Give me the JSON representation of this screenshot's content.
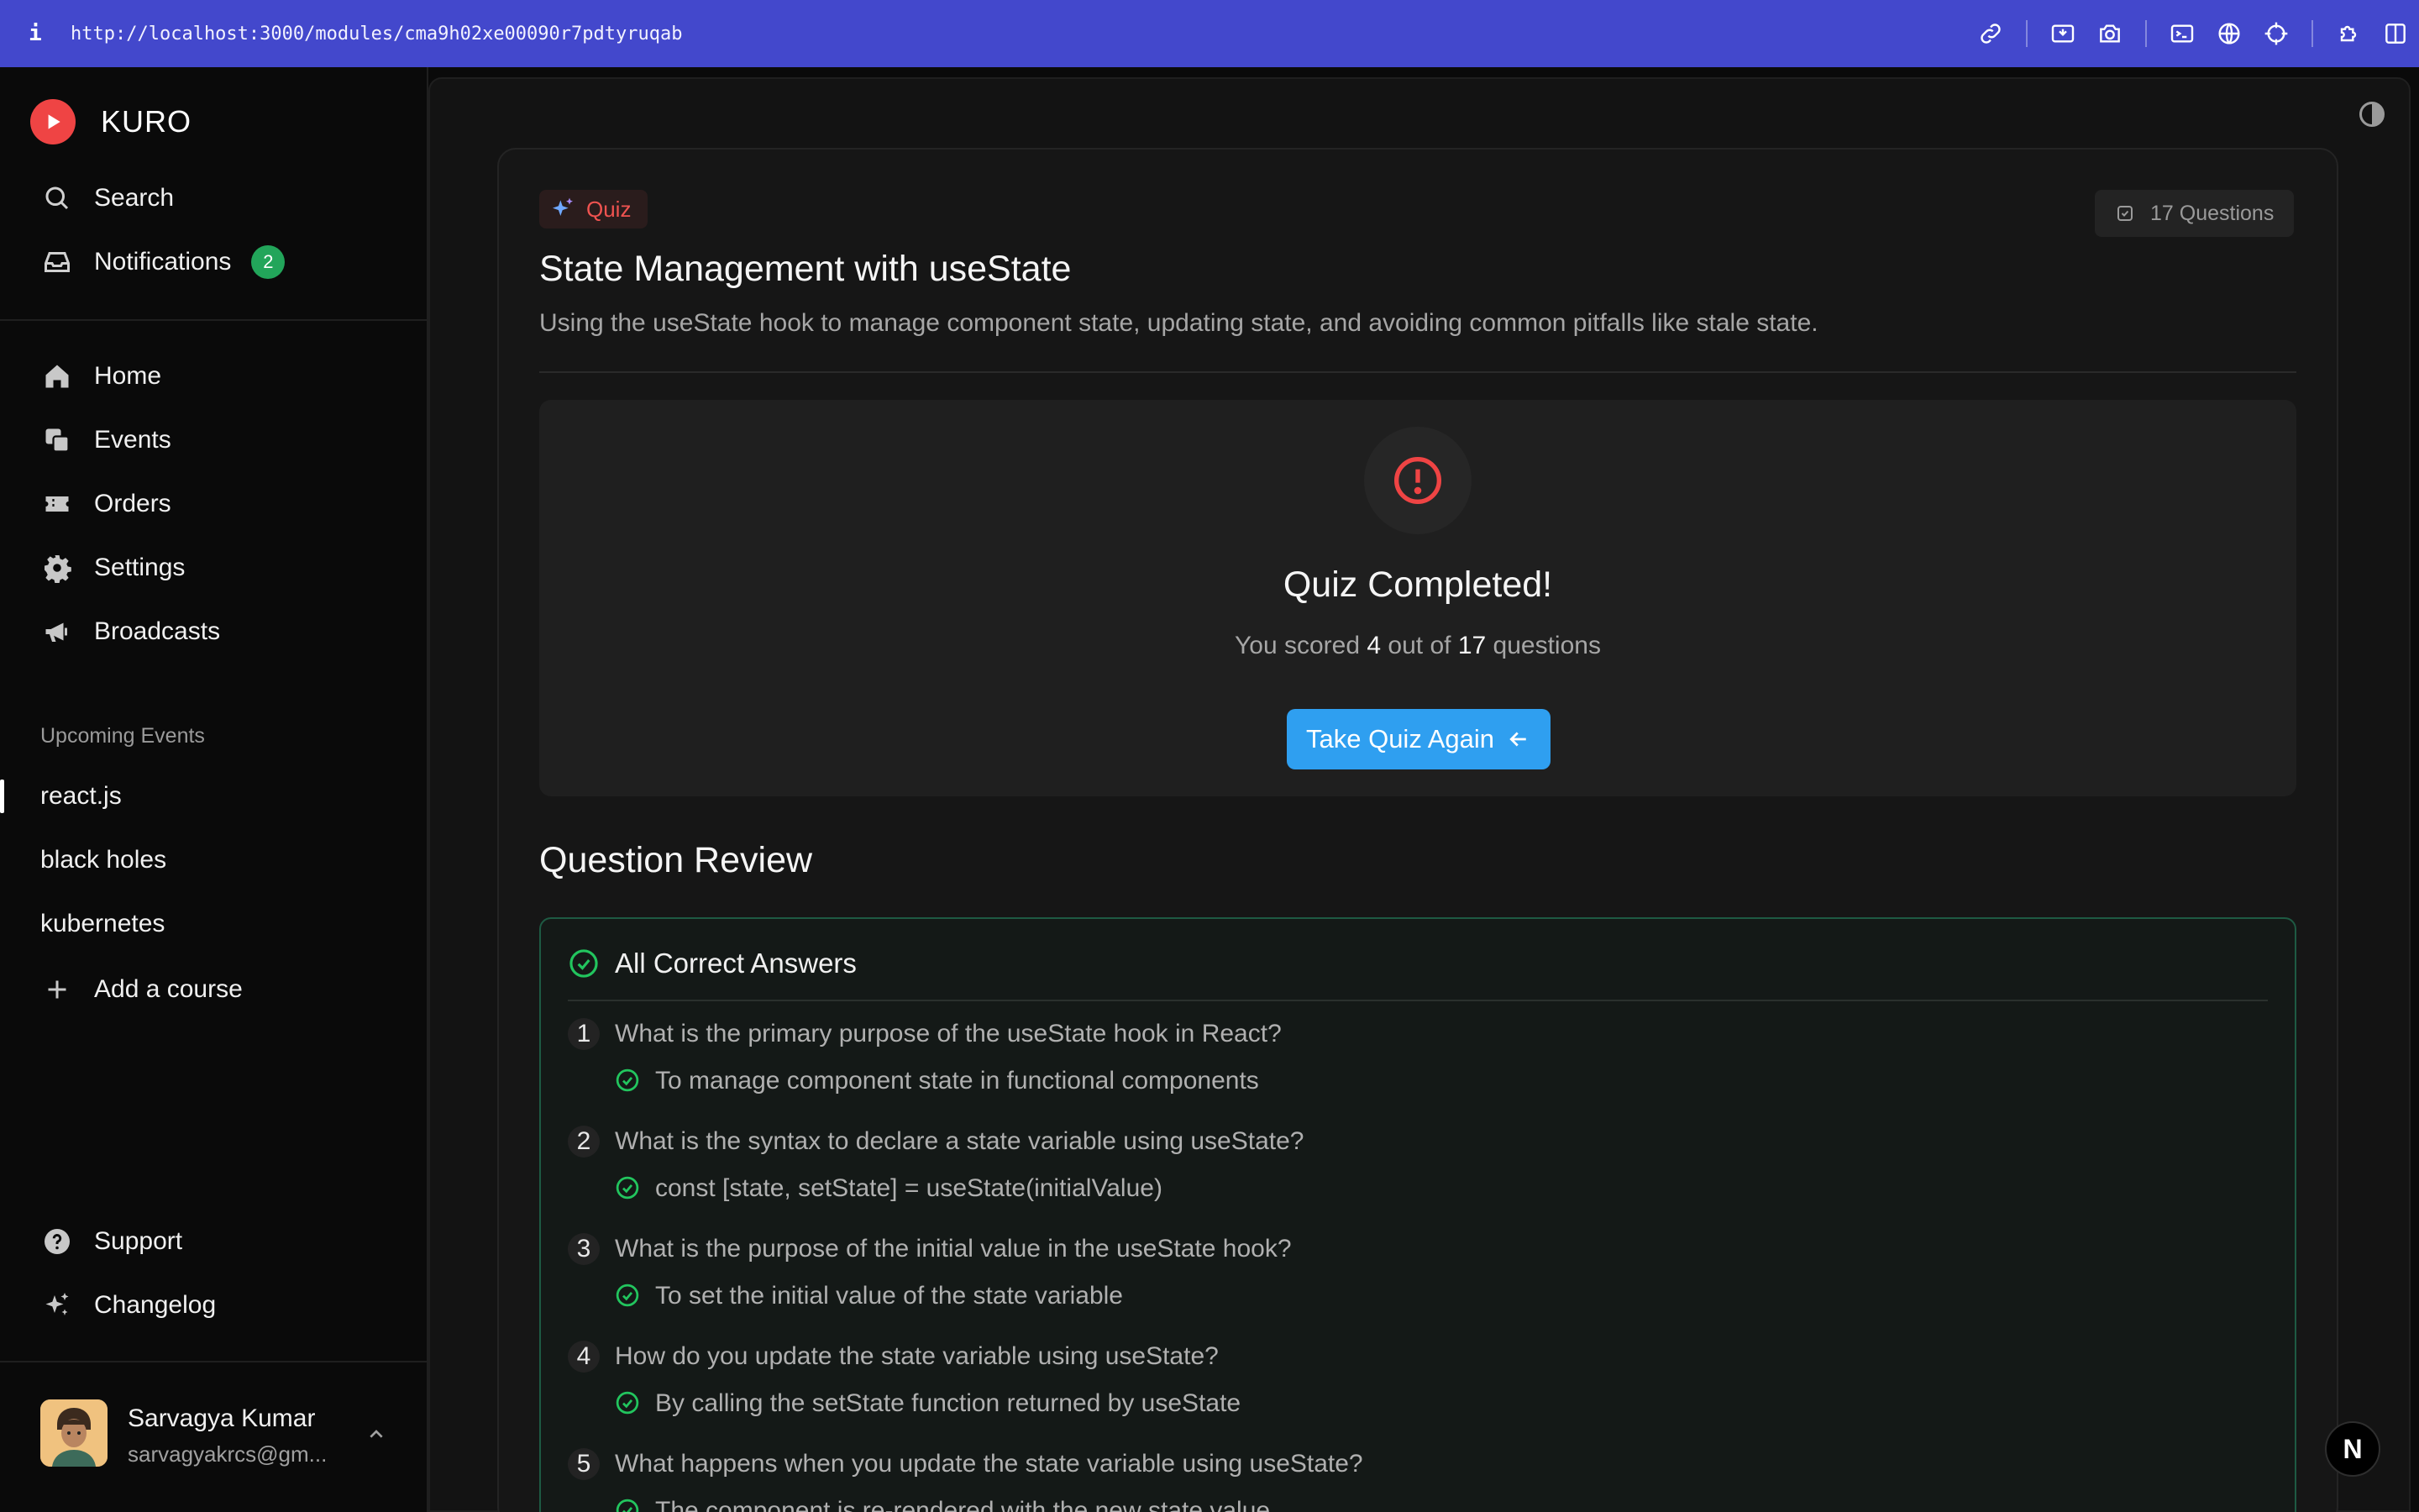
{
  "browser": {
    "info": "i",
    "url": "http://localhost:3000/modules/cma9h02xe00090r7pdtyruqab"
  },
  "sidebar": {
    "brand": "KURO",
    "search": "Search",
    "notifications": "Notifications",
    "notifications_count": "2",
    "nav": {
      "home": "Home",
      "events": "Events",
      "orders": "Orders",
      "settings": "Settings",
      "broadcasts": "Broadcasts"
    },
    "upcoming_label": "Upcoming Events",
    "courses": [
      "react.js",
      "black holes",
      "kubernetes"
    ],
    "add_course": "Add a course",
    "support": "Support",
    "changelog": "Changelog",
    "user": {
      "name": "Sarvagya Kumar",
      "email": "sarvagyakrcs@gm..."
    }
  },
  "module": {
    "tag": "Quiz",
    "question_count": "17 Questions",
    "title": "State Management with useState",
    "description": "Using the useState hook to manage component state, updating state, and avoiding common pitfalls like stale state."
  },
  "result": {
    "heading": "Quiz Completed!",
    "score_prefix": "You scored",
    "score": "4",
    "score_mid": "out of",
    "total": "17",
    "score_suffix": "questions",
    "retake_label": "Take Quiz Again"
  },
  "review": {
    "title": "Question Review",
    "answers_heading": "All Correct Answers",
    "items": [
      {
        "num": "1",
        "question": "What is the primary purpose of the useState hook in React?",
        "answer": "To manage component state in functional components"
      },
      {
        "num": "2",
        "question": "What is the syntax to declare a state variable using useState?",
        "answer": "const [state, setState] = useState(initialValue)"
      },
      {
        "num": "3",
        "question": "What is the purpose of the initial value in the useState hook?",
        "answer": "To set the initial value of the state variable"
      },
      {
        "num": "4",
        "question": "How do you update the state variable using useState?",
        "answer": "By calling the setState function returned by useState"
      },
      {
        "num": "5",
        "question": "What happens when you update the state variable using useState?",
        "answer": "The component is re-rendered with the new state value"
      }
    ]
  },
  "dev_badge": "N",
  "colors": {
    "accent": "#2f9ff0",
    "danger": "#ef4444",
    "success": "#22c55e",
    "browser_bar": "#4348cc"
  }
}
